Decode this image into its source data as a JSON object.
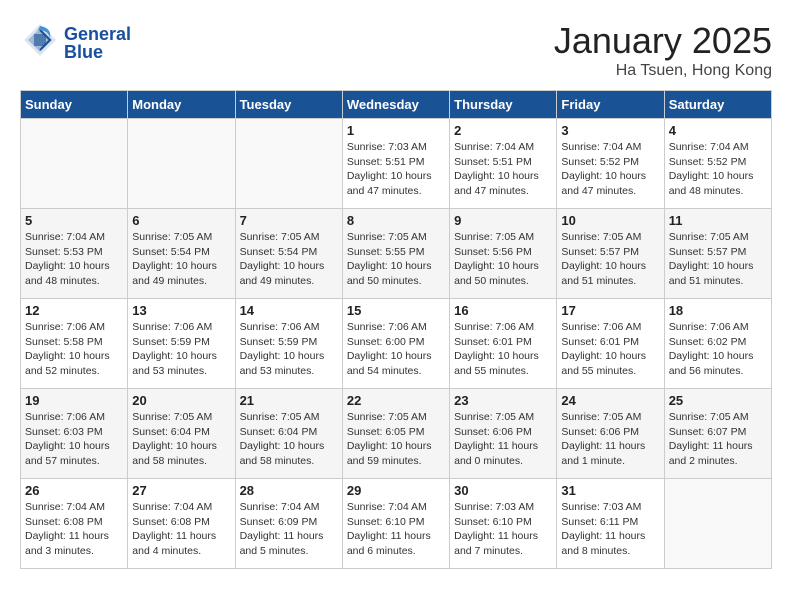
{
  "header": {
    "logo_general": "General",
    "logo_blue": "Blue",
    "title": "January 2025",
    "subtitle": "Ha Tsuen, Hong Kong"
  },
  "days_of_week": [
    "Sunday",
    "Monday",
    "Tuesday",
    "Wednesday",
    "Thursday",
    "Friday",
    "Saturday"
  ],
  "weeks": [
    [
      {
        "day": "",
        "info": ""
      },
      {
        "day": "",
        "info": ""
      },
      {
        "day": "",
        "info": ""
      },
      {
        "day": "1",
        "info": "Sunrise: 7:03 AM\nSunset: 5:51 PM\nDaylight: 10 hours\nand 47 minutes."
      },
      {
        "day": "2",
        "info": "Sunrise: 7:04 AM\nSunset: 5:51 PM\nDaylight: 10 hours\nand 47 minutes."
      },
      {
        "day": "3",
        "info": "Sunrise: 7:04 AM\nSunset: 5:52 PM\nDaylight: 10 hours\nand 47 minutes."
      },
      {
        "day": "4",
        "info": "Sunrise: 7:04 AM\nSunset: 5:52 PM\nDaylight: 10 hours\nand 48 minutes."
      }
    ],
    [
      {
        "day": "5",
        "info": "Sunrise: 7:04 AM\nSunset: 5:53 PM\nDaylight: 10 hours\nand 48 minutes."
      },
      {
        "day": "6",
        "info": "Sunrise: 7:05 AM\nSunset: 5:54 PM\nDaylight: 10 hours\nand 49 minutes."
      },
      {
        "day": "7",
        "info": "Sunrise: 7:05 AM\nSunset: 5:54 PM\nDaylight: 10 hours\nand 49 minutes."
      },
      {
        "day": "8",
        "info": "Sunrise: 7:05 AM\nSunset: 5:55 PM\nDaylight: 10 hours\nand 50 minutes."
      },
      {
        "day": "9",
        "info": "Sunrise: 7:05 AM\nSunset: 5:56 PM\nDaylight: 10 hours\nand 50 minutes."
      },
      {
        "day": "10",
        "info": "Sunrise: 7:05 AM\nSunset: 5:57 PM\nDaylight: 10 hours\nand 51 minutes."
      },
      {
        "day": "11",
        "info": "Sunrise: 7:05 AM\nSunset: 5:57 PM\nDaylight: 10 hours\nand 51 minutes."
      }
    ],
    [
      {
        "day": "12",
        "info": "Sunrise: 7:06 AM\nSunset: 5:58 PM\nDaylight: 10 hours\nand 52 minutes."
      },
      {
        "day": "13",
        "info": "Sunrise: 7:06 AM\nSunset: 5:59 PM\nDaylight: 10 hours\nand 53 minutes."
      },
      {
        "day": "14",
        "info": "Sunrise: 7:06 AM\nSunset: 5:59 PM\nDaylight: 10 hours\nand 53 minutes."
      },
      {
        "day": "15",
        "info": "Sunrise: 7:06 AM\nSunset: 6:00 PM\nDaylight: 10 hours\nand 54 minutes."
      },
      {
        "day": "16",
        "info": "Sunrise: 7:06 AM\nSunset: 6:01 PM\nDaylight: 10 hours\nand 55 minutes."
      },
      {
        "day": "17",
        "info": "Sunrise: 7:06 AM\nSunset: 6:01 PM\nDaylight: 10 hours\nand 55 minutes."
      },
      {
        "day": "18",
        "info": "Sunrise: 7:06 AM\nSunset: 6:02 PM\nDaylight: 10 hours\nand 56 minutes."
      }
    ],
    [
      {
        "day": "19",
        "info": "Sunrise: 7:06 AM\nSunset: 6:03 PM\nDaylight: 10 hours\nand 57 minutes."
      },
      {
        "day": "20",
        "info": "Sunrise: 7:05 AM\nSunset: 6:04 PM\nDaylight: 10 hours\nand 58 minutes."
      },
      {
        "day": "21",
        "info": "Sunrise: 7:05 AM\nSunset: 6:04 PM\nDaylight: 10 hours\nand 58 minutes."
      },
      {
        "day": "22",
        "info": "Sunrise: 7:05 AM\nSunset: 6:05 PM\nDaylight: 10 hours\nand 59 minutes."
      },
      {
        "day": "23",
        "info": "Sunrise: 7:05 AM\nSunset: 6:06 PM\nDaylight: 11 hours\nand 0 minutes."
      },
      {
        "day": "24",
        "info": "Sunrise: 7:05 AM\nSunset: 6:06 PM\nDaylight: 11 hours\nand 1 minute."
      },
      {
        "day": "25",
        "info": "Sunrise: 7:05 AM\nSunset: 6:07 PM\nDaylight: 11 hours\nand 2 minutes."
      }
    ],
    [
      {
        "day": "26",
        "info": "Sunrise: 7:04 AM\nSunset: 6:08 PM\nDaylight: 11 hours\nand 3 minutes."
      },
      {
        "day": "27",
        "info": "Sunrise: 7:04 AM\nSunset: 6:08 PM\nDaylight: 11 hours\nand 4 minutes."
      },
      {
        "day": "28",
        "info": "Sunrise: 7:04 AM\nSunset: 6:09 PM\nDaylight: 11 hours\nand 5 minutes."
      },
      {
        "day": "29",
        "info": "Sunrise: 7:04 AM\nSunset: 6:10 PM\nDaylight: 11 hours\nand 6 minutes."
      },
      {
        "day": "30",
        "info": "Sunrise: 7:03 AM\nSunset: 6:10 PM\nDaylight: 11 hours\nand 7 minutes."
      },
      {
        "day": "31",
        "info": "Sunrise: 7:03 AM\nSunset: 6:11 PM\nDaylight: 11 hours\nand 8 minutes."
      },
      {
        "day": "",
        "info": ""
      }
    ]
  ]
}
